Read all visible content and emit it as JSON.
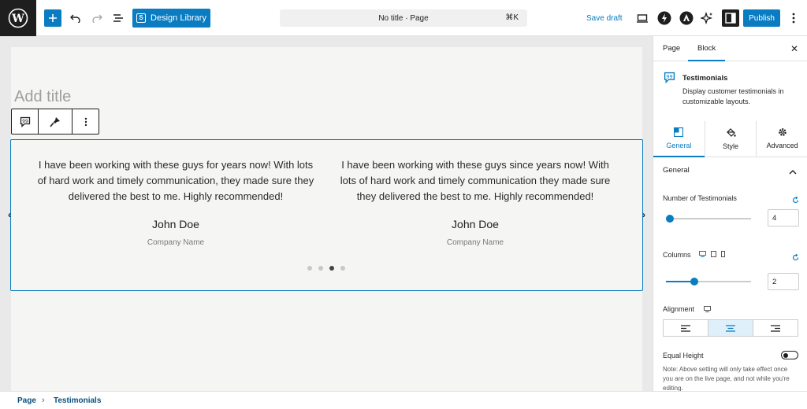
{
  "header": {
    "design_library_label": "Design Library",
    "command_bar_text": "No title · Page",
    "command_shortcut": "⌘K",
    "save_draft_label": "Save draft",
    "publish_label": "Publish"
  },
  "editor": {
    "title_placeholder": "Add title",
    "testimonials": [
      {
        "quote": "I have been working with these guys for years now! With lots of hard work and timely communication, they made sure they delivered the best to me. Highly recommended!",
        "name": "John Doe",
        "company": "Company Name"
      },
      {
        "quote": "I have been working with these guys since years now! With lots of hard work and timely communication they made sure they delivered the best to me. Highly recommended!",
        "name": "John Doe",
        "company": "Company Name"
      }
    ],
    "pagination": {
      "total": 4,
      "active_index": 2
    },
    "prev_arrow": "‹",
    "next_arrow": "›"
  },
  "breadcrumb": {
    "items": [
      "Page",
      "Testimonials"
    ],
    "separator": "›"
  },
  "sidebar": {
    "tabs": [
      "Page",
      "Block"
    ],
    "active_tab": "Block",
    "close_glyph": "✕",
    "block": {
      "title": "Testimonials",
      "description": "Display customer testimonials in customizable layouts."
    },
    "panel_tabs": [
      "General",
      "Style",
      "Advanced"
    ],
    "active_panel": "General",
    "section_title": "General",
    "number_of_testimonials": {
      "label": "Number of Testimonials",
      "value": "4",
      "fraction": 0.05
    },
    "columns": {
      "label": "Columns",
      "value": "2",
      "fraction": 0.33
    },
    "alignment": {
      "label": "Alignment",
      "options": [
        "left",
        "center",
        "right"
      ],
      "active": "center"
    },
    "equal_height": {
      "label": "Equal Height",
      "enabled": false
    },
    "note": "Note: Above setting will only take effect once you are on the live page, and not while you're editing."
  },
  "colors": {
    "accent": "#0a7cc1",
    "dark": "#1e1e1e",
    "canvas": "#f5f5f3"
  },
  "icons": {
    "wordpress": "wordpress-logo-icon",
    "undo": "undo-icon",
    "redo": "redo-icon",
    "list_view": "list-view-icon",
    "preview": "preview-desktop-icon",
    "bolt": "bolt-icon",
    "astra": "astra-icon",
    "ai": "ai-sparkle-icon",
    "settings": "settings-sidebar-icon",
    "more": "more-vertical-icon"
  }
}
